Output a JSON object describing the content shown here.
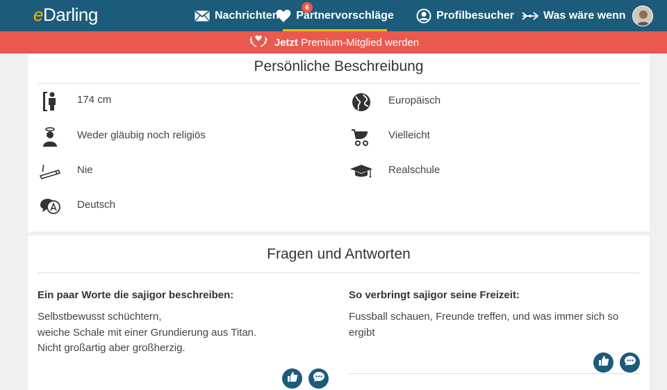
{
  "header": {
    "logo_e": "e",
    "logo_rest": "Darling",
    "nav": {
      "messages": "Nachrichten",
      "partner": "Partnervorschläge",
      "partner_badge": "6",
      "visitors": "Profilbesucher",
      "whatif": "Was wäre wenn"
    }
  },
  "premium": {
    "strong": "Jetzt",
    "text": "Premium-Mitglied werden"
  },
  "description": {
    "title": "Persönliche Beschreibung",
    "items": [
      {
        "icon": "height-icon",
        "text": "174 cm"
      },
      {
        "icon": "globe-icon",
        "text": "Europäisch"
      },
      {
        "icon": "religion-icon",
        "text": "Weder gläubig noch religiös"
      },
      {
        "icon": "stroller-icon",
        "text": "Vielleicht"
      },
      {
        "icon": "smoking-icon",
        "text": "Nie"
      },
      {
        "icon": "graduation-cap-icon",
        "text": "Realschule"
      },
      {
        "icon": "language-icon",
        "text": "Deutsch"
      }
    ]
  },
  "qa": {
    "title": "Fragen und Antworten",
    "left": {
      "question": "Ein paar Worte die sajigor beschreiben:",
      "answer_lines": [
        "Selbstbewusst schüchtern,",
        "weiche Schale mit einer Grundierung aus Titan.",
        "Nicht großartig aber großherzig."
      ]
    },
    "right": {
      "question": "So verbringt sajigor seine Freizeit:",
      "answer_lines": [
        "Fussball schauen, Freunde treffen, und was immer sich so",
        "ergibt"
      ]
    }
  },
  "colors": {
    "nav_bg": "#1c5b7a",
    "accent": "#f4b800",
    "premium_bg": "#e9594f"
  }
}
